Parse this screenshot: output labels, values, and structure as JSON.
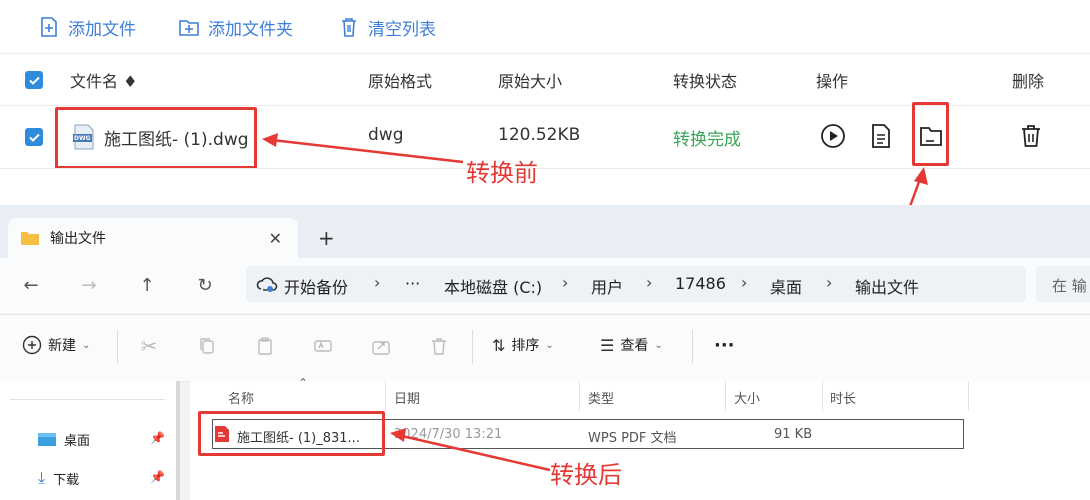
{
  "toolbar": {
    "add_file": "添加文件",
    "add_folder": "添加文件夹",
    "clear_list": "清空列表"
  },
  "table": {
    "headers": {
      "name": "文件名 ♦",
      "orig_format": "原始格式",
      "orig_size": "原始大小",
      "status": "转换状态",
      "actions": "操作",
      "delete": "删除"
    },
    "rows": [
      {
        "name": "施工图纸- (1).dwg",
        "format": "dwg",
        "size": "120.52KB",
        "status": "转换完成",
        "file_icon_text": "DWG"
      }
    ]
  },
  "annotations": {
    "before": "转换前",
    "after": "转换后",
    "color": "#e53935"
  },
  "explorer": {
    "tab_title": "输出文件",
    "new_tab": "+",
    "breadcrumb": {
      "home": "开始备份",
      "more": "···",
      "items": [
        "本地磁盘 (C:)",
        "用户",
        "17486",
        "桌面",
        "输出文件"
      ]
    },
    "search_placeholder": "在 输",
    "commands": {
      "new": "新建",
      "sort": "排序",
      "view": "查看",
      "more": "···"
    },
    "columns": {
      "name": "名称",
      "date": "日期",
      "type": "类型",
      "size": "大小",
      "duration": "时长"
    },
    "sidebar": [
      {
        "label": "桌面"
      },
      {
        "label": "下载"
      }
    ],
    "files": [
      {
        "name": "施工图纸- (1)_831...",
        "date": "2024/7/30 13:21",
        "type": "WPS PDF 文档",
        "size": "91 KB"
      }
    ]
  },
  "colors": {
    "accent_blue": "#3f7fd8",
    "checkbox_blue": "#2f8bdc",
    "status_green": "#3aa65a"
  }
}
